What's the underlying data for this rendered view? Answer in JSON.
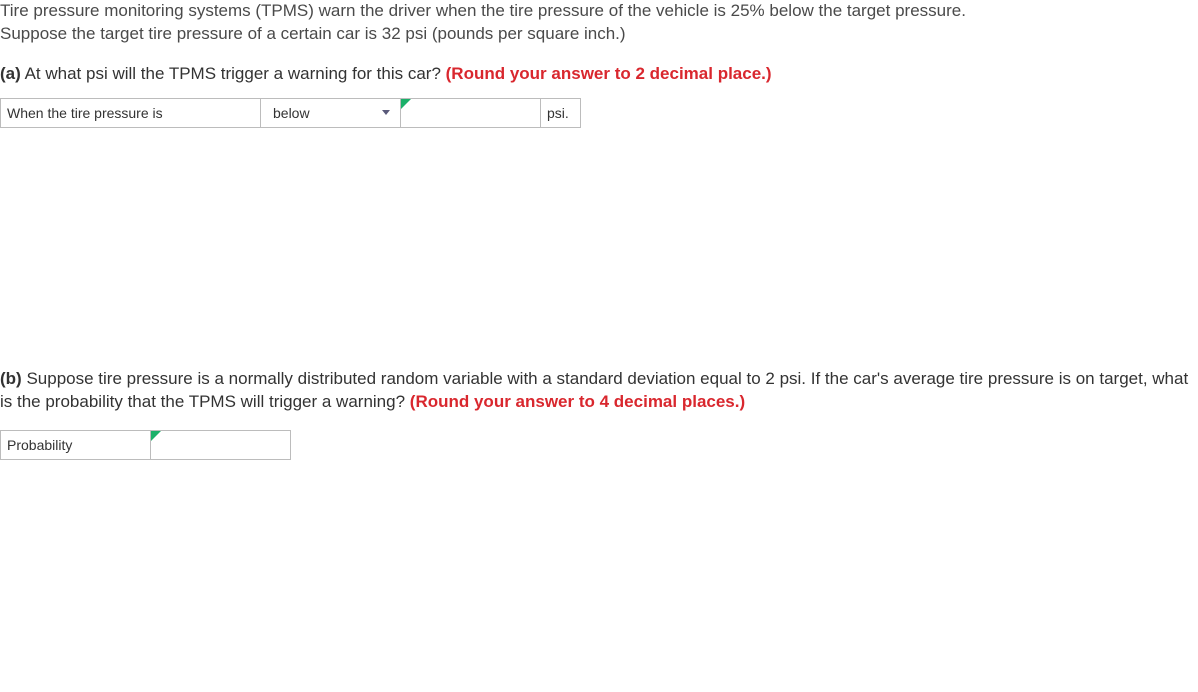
{
  "intro": {
    "line1": "Tire pressure monitoring systems (TPMS) warn the driver when the tire pressure of the vehicle is 25% below the target pressure.",
    "line2": "Suppose the target tire pressure of a certain car is 32 psi (pounds per square inch.)"
  },
  "partA": {
    "label": "(a)",
    "question": " At what psi will the TPMS trigger a warning for this car? ",
    "hint": "(Round your answer to 2 decimal place.)",
    "row": {
      "prefix": "When the tire pressure is",
      "dropdown_value": "below",
      "unit": "psi."
    }
  },
  "partB": {
    "label": "(b)",
    "question": " Suppose tire pressure is a normally distributed random variable with a standard deviation equal to 2 psi. If the car's average tire pressure is on target, what is the probability that the TPMS will trigger a warning? ",
    "hint": "(Round your answer to 4 decimal places.)",
    "row": {
      "prefix": "Probability"
    }
  }
}
